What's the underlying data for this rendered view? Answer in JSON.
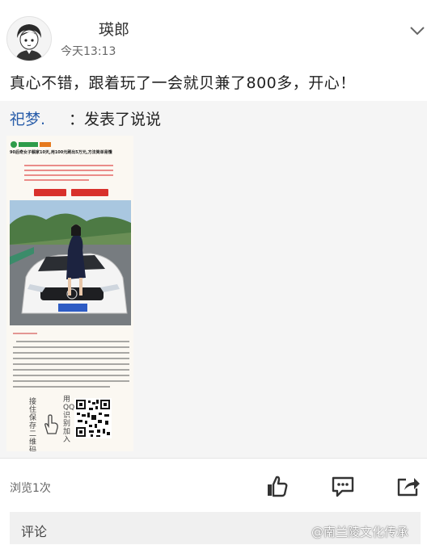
{
  "post": {
    "author": "瑛郎",
    "time": "今天13:13",
    "text": "真心不错，跟着玩了一会就贝兼了800多，开心！"
  },
  "repost": {
    "author": "祀梦.",
    "action": "：发表了说说"
  },
  "ad": {
    "headline": "90后奇女子躺家10天,用100元刷出5万元,方法简单易懂",
    "vertical_text_1": "接住保存二维码",
    "vertical_text_2": "用QQ识别加入"
  },
  "footer": {
    "views": "浏览1次",
    "comment_label": "评论",
    "watermark": "@南兰陵文化传承"
  },
  "colors": {
    "link_blue": "#2a5eaa",
    "icon_dark": "#333333"
  },
  "icons": [
    "avatar",
    "chevron-down-icon",
    "like-icon",
    "comment-icon",
    "share-icon",
    "weibo-icon"
  ]
}
